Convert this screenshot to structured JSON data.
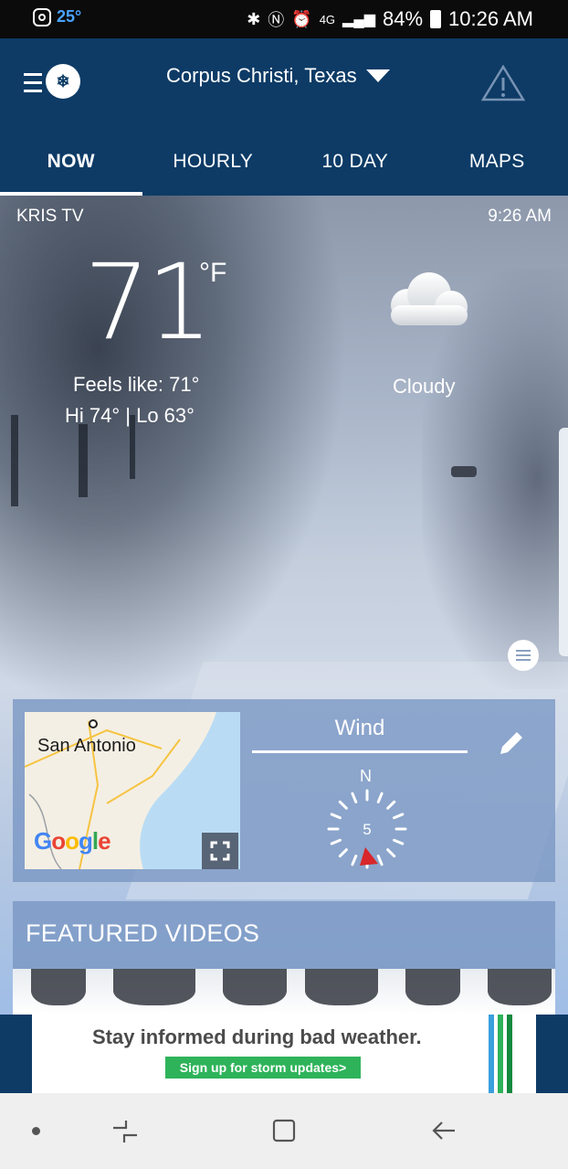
{
  "status_bar": {
    "weather_temp": "25°",
    "battery": "84%",
    "time": "10:26 AM",
    "icons": [
      "instagram-icon",
      "bluetooth-icon",
      "nfc-icon",
      "alarm-icon",
      "lte-icon",
      "signal-icon",
      "battery-icon"
    ]
  },
  "header": {
    "location": "Corpus Christi, Texas",
    "menu_icon": "menu-icon",
    "alert_icon": "warning-icon"
  },
  "tabs": [
    {
      "label": "NOW",
      "active": true
    },
    {
      "label": "HOURLY",
      "active": false
    },
    {
      "label": "10 DAY",
      "active": false
    },
    {
      "label": "MAPS",
      "active": false
    }
  ],
  "current": {
    "source": "KRIS TV",
    "time": "9:26 AM",
    "temperature": "71",
    "unit": "°F",
    "feels_like": "Feels like: 71°",
    "hi_lo": "Hi 74° | Lo 63°",
    "condition": "Cloudy",
    "condition_icon": "cloud-icon"
  },
  "map_card": {
    "city_label": "San Antonio",
    "attribution": "Google",
    "wind_title": "Wind",
    "wind_direction_label": "N",
    "wind_speed": "5"
  },
  "featured": {
    "title": "FEATURED VIDEOS"
  },
  "ad": {
    "headline": "Stay informed during bad weather.",
    "cta": "Sign up for storm updates>"
  },
  "colors": {
    "header_bg": "#0d3b66",
    "accent_blue": "#4aa3ff",
    "ad_green": "#2eb35a",
    "wind_arrow": "#d8262a"
  }
}
